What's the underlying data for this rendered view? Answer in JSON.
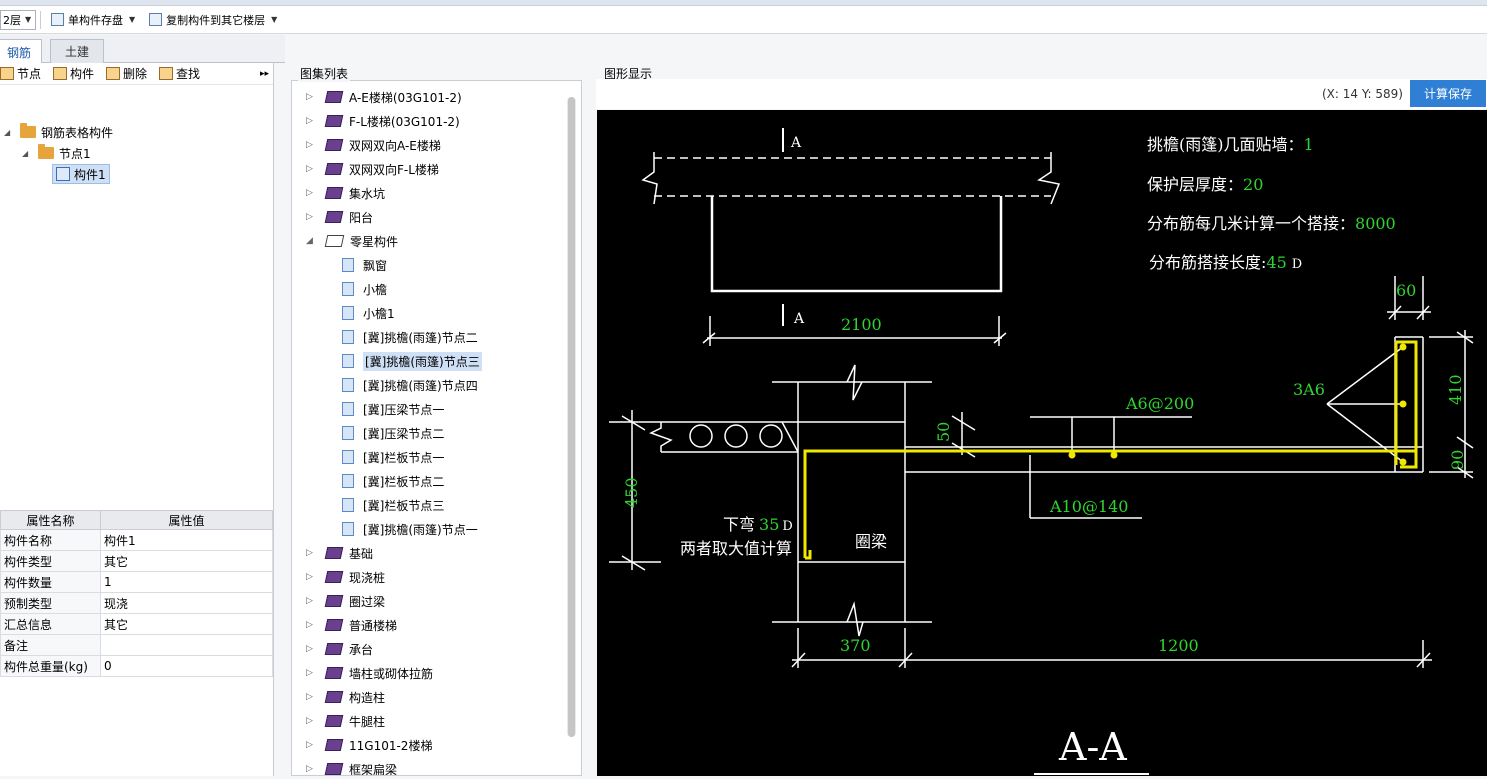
{
  "toolbar": {
    "floor_value": "2层",
    "save_component_label": "单构件存盘",
    "copy_to_floor_label": "复制构件到其它楼层"
  },
  "tabs": {
    "rebar": "钢筋",
    "civil": "土建"
  },
  "left_tools": {
    "node": "节点",
    "component": "构件",
    "delete": "删除",
    "find": "查找"
  },
  "tree": {
    "root": "钢筋表格构件",
    "node": "节点1",
    "leaf": "构件1"
  },
  "properties": {
    "col_name": "属性名称",
    "col_value": "属性值",
    "rows": [
      {
        "k": "构件名称",
        "v": "构件1"
      },
      {
        "k": "构件类型",
        "v": "其它"
      },
      {
        "k": "构件数量",
        "v": "1"
      },
      {
        "k": "预制类型",
        "v": "现浇"
      },
      {
        "k": "汇总信息",
        "v": "其它"
      },
      {
        "k": "备注",
        "v": ""
      },
      {
        "k": "构件总重量(kg)",
        "v": "0"
      }
    ]
  },
  "library": {
    "title": "图集列表",
    "items": [
      {
        "label": "A-E楼梯(03G101-2)",
        "kind": "book"
      },
      {
        "label": "F-L楼梯(03G101-2)",
        "kind": "book"
      },
      {
        "label": "双网双向A-E楼梯",
        "kind": "book"
      },
      {
        "label": "双网双向F-L楼梯",
        "kind": "book"
      },
      {
        "label": "集水坑",
        "kind": "book"
      },
      {
        "label": "阳台",
        "kind": "book"
      },
      {
        "label": "零星构件",
        "kind": "open"
      },
      {
        "label": "飘窗",
        "kind": "page"
      },
      {
        "label": "小檐",
        "kind": "page"
      },
      {
        "label": "小檐1",
        "kind": "page"
      },
      {
        "label": "[冀]挑檐(雨篷)节点二",
        "kind": "page"
      },
      {
        "label": "[冀]挑檐(雨篷)节点三",
        "kind": "page",
        "selected": true
      },
      {
        "label": "[冀]挑檐(雨篷)节点四",
        "kind": "page"
      },
      {
        "label": "[冀]压梁节点一",
        "kind": "page"
      },
      {
        "label": "[冀]压梁节点二",
        "kind": "page"
      },
      {
        "label": "[冀]栏板节点一",
        "kind": "page"
      },
      {
        "label": "[冀]栏板节点二",
        "kind": "page"
      },
      {
        "label": "[冀]栏板节点三",
        "kind": "page"
      },
      {
        "label": "[冀]挑檐(雨篷)节点一",
        "kind": "page"
      },
      {
        "label": "基础",
        "kind": "book"
      },
      {
        "label": "现浇桩",
        "kind": "book"
      },
      {
        "label": "圈过梁",
        "kind": "book"
      },
      {
        "label": "普通楼梯",
        "kind": "book"
      },
      {
        "label": "承台",
        "kind": "book"
      },
      {
        "label": "墙柱或砌体拉筋",
        "kind": "book"
      },
      {
        "label": "构造柱",
        "kind": "book"
      },
      {
        "label": "牛腿柱",
        "kind": "book"
      },
      {
        "label": "11G101-2楼梯",
        "kind": "book"
      },
      {
        "label": "框架扁梁",
        "kind": "book"
      }
    ]
  },
  "graphic": {
    "title": "图形显示",
    "coord_text": "(X: 14 Y: 589)",
    "save_button": "计算保存"
  },
  "drawing": {
    "section_mark_top": "A",
    "section_mark_bottom": "A",
    "plan_width": "2100",
    "info1_label": "挑檐(雨篷)几面贴墙：",
    "info1_value": "1",
    "info2_label": "保护层厚度：",
    "info2_value": "20",
    "info3_label": "分布筋每几米计算一个搭接：",
    "info3_value": "8000",
    "info4_label": "分布筋搭接长度:",
    "info4_value": "45",
    "info4_unit": "D",
    "dim_60": "60",
    "dim_410": "410",
    "dim_90": "90",
    "dim_450": "450",
    "dim_50": "50",
    "dim_370": "370",
    "dim_1200": "1200",
    "rebar_3a6": "3A6",
    "rebar_a6": "A6@200",
    "rebar_a10": "A10@140",
    "bend_label": "下弯",
    "bend_value": "35",
    "bend_unit": "D",
    "bend_note": "两者取大值计算",
    "ring_beam": "圈梁",
    "section_title": "A-A",
    "colors": {
      "line": "#ffffff",
      "dim_text": "#2fd52f",
      "rebar": "#f0e800"
    }
  }
}
